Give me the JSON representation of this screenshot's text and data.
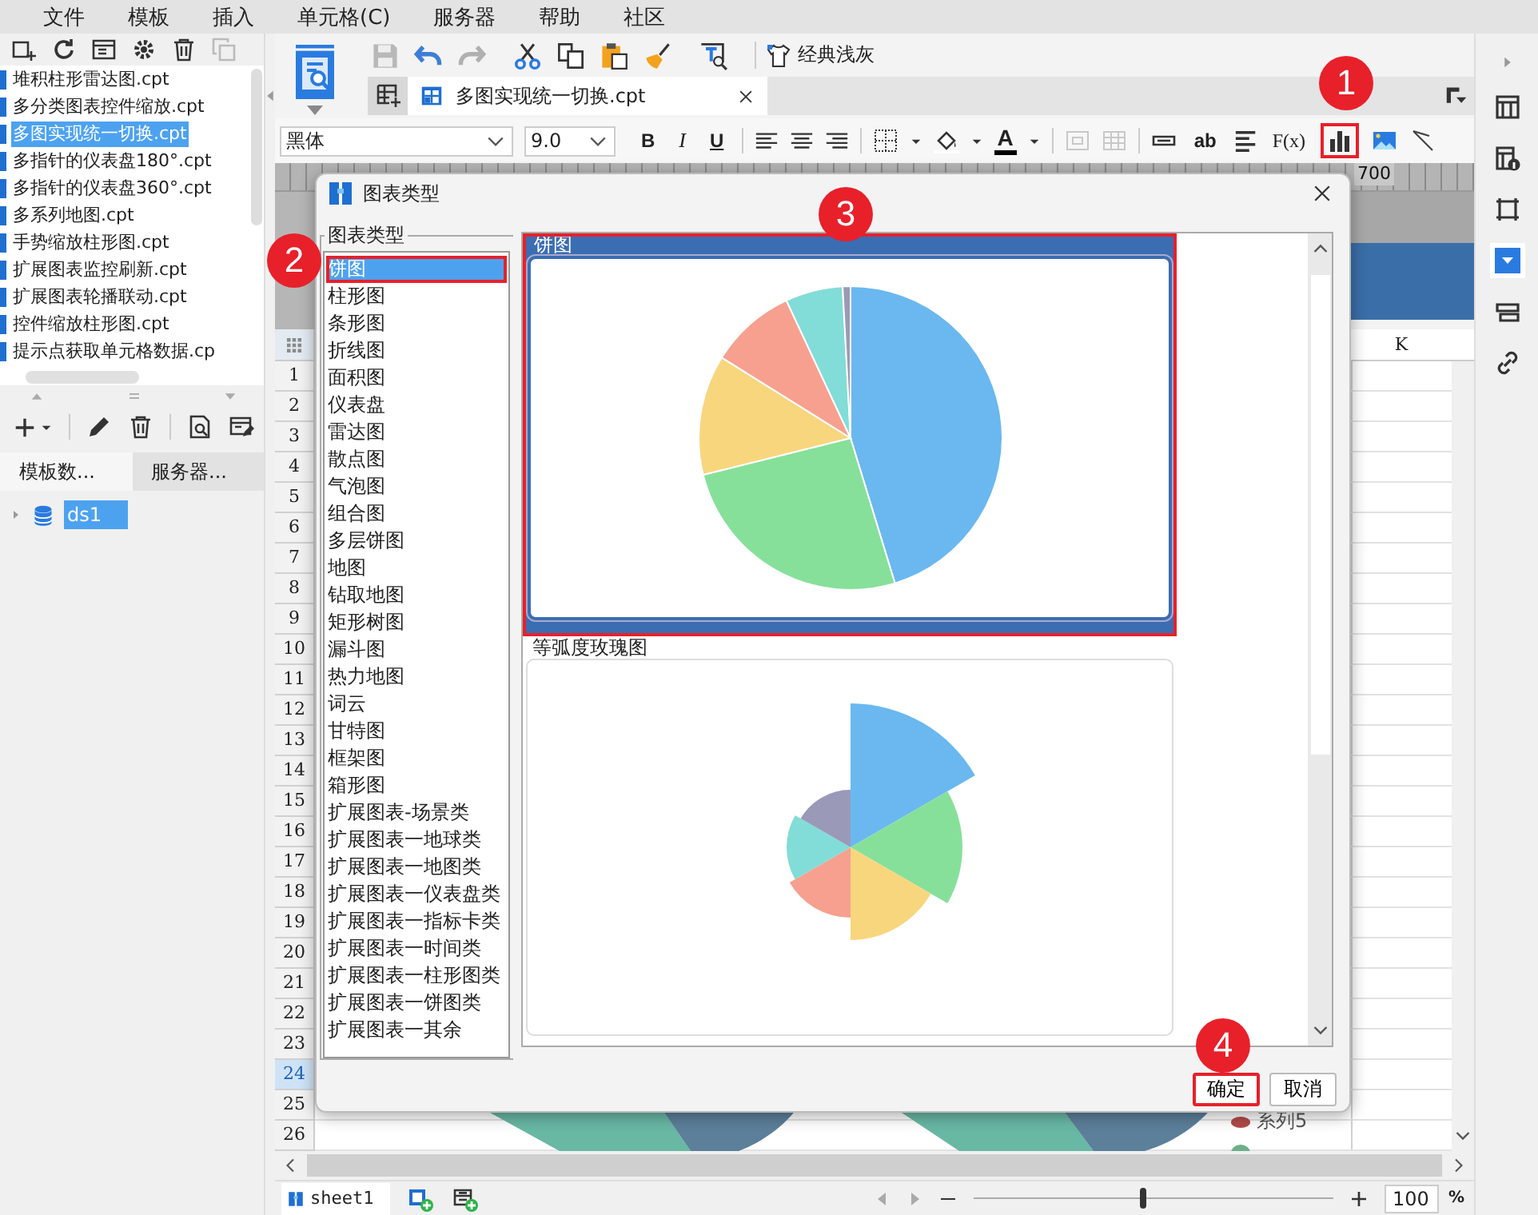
{
  "menu": [
    "文件",
    "模板",
    "插入",
    "单元格(C)",
    "服务器",
    "帮助",
    "社区"
  ],
  "files": [
    {
      "name": "堆积柱形雷达图.cpt",
      "selected": false
    },
    {
      "name": "多分类图表控件缩放.cpt",
      "selected": false
    },
    {
      "name": "多图实现统一切换.cpt",
      "selected": true
    },
    {
      "name": "多指针的仪表盘180°.cpt",
      "selected": false
    },
    {
      "name": "多指针的仪表盘360°.cpt",
      "selected": false
    },
    {
      "name": "多系列地图.cpt",
      "selected": false
    },
    {
      "name": "手势缩放柱形图.cpt",
      "selected": false
    },
    {
      "name": "扩展图表监控刷新.cpt",
      "selected": false
    },
    {
      "name": "扩展图表轮播联动.cpt",
      "selected": false
    },
    {
      "name": "控件缩放柱形图.cpt",
      "selected": false
    },
    {
      "name": "提示点获取单元格数据.cp",
      "selected": false
    }
  ],
  "panel_tabs": [
    {
      "label": "模板数...",
      "selected": true
    },
    {
      "label": "服务器...",
      "selected": false
    }
  ],
  "datasources": [
    {
      "label": "ds1",
      "selected": true
    }
  ],
  "toolbar": {
    "theme_button": "经典浅灰"
  },
  "document_tab": {
    "title": "多图实现统一切换.cpt"
  },
  "format_bar": {
    "chart_marked": true,
    "font": "黑体",
    "size": "9.0",
    "bold": "B",
    "italic": "I",
    "underline": "U",
    "font_color": "A",
    "text_tool": "ab",
    "formula": "F(x)"
  },
  "ruler": {
    "label": "700"
  },
  "sheet": {
    "column_header": "K",
    "legend": [
      "系列5"
    ],
    "rows": [
      {
        "label": "1",
        "selected": false
      },
      {
        "label": "2",
        "selected": false
      },
      {
        "label": "3",
        "selected": false
      },
      {
        "label": "4",
        "selected": false
      },
      {
        "label": "5",
        "selected": false
      },
      {
        "label": "6",
        "selected": false
      },
      {
        "label": "7",
        "selected": false
      },
      {
        "label": "8",
        "selected": false
      },
      {
        "label": "9",
        "selected": false
      },
      {
        "label": "10",
        "selected": false
      },
      {
        "label": "11",
        "selected": false
      },
      {
        "label": "12",
        "selected": false
      },
      {
        "label": "13",
        "selected": false
      },
      {
        "label": "14",
        "selected": false
      },
      {
        "label": "15",
        "selected": false
      },
      {
        "label": "16",
        "selected": false
      },
      {
        "label": "17",
        "selected": false
      },
      {
        "label": "18",
        "selected": false
      },
      {
        "label": "19",
        "selected": false
      },
      {
        "label": "20",
        "selected": false
      },
      {
        "label": "21",
        "selected": false
      },
      {
        "label": "22",
        "selected": false
      },
      {
        "label": "23",
        "selected": false
      },
      {
        "label": "24",
        "selected": true
      },
      {
        "label": "25",
        "selected": false
      },
      {
        "label": "26",
        "selected": false
      }
    ]
  },
  "side_tools": [
    {
      "selected": false
    },
    {
      "selected": false
    },
    {
      "selected": false
    },
    {
      "selected": true
    },
    {
      "selected": false
    },
    {
      "selected": false
    }
  ],
  "status": {
    "sheet_tab": "sheet1",
    "zoom": "100",
    "zoom_unit": "%",
    "level": 0.47
  },
  "dialog": {
    "title": "图表类型",
    "group_label": "图表类型",
    "marked_chart_type": true,
    "chart_types": [
      {
        "label": "饼图",
        "selected": true
      },
      {
        "label": "柱形图",
        "selected": false
      },
      {
        "label": "条形图",
        "selected": false
      },
      {
        "label": "折线图",
        "selected": false
      },
      {
        "label": "面积图",
        "selected": false
      },
      {
        "label": "仪表盘",
        "selected": false
      },
      {
        "label": "雷达图",
        "selected": false
      },
      {
        "label": "散点图",
        "selected": false
      },
      {
        "label": "气泡图",
        "selected": false
      },
      {
        "label": "组合图",
        "selected": false
      },
      {
        "label": "多层饼图",
        "selected": false
      },
      {
        "label": "地图",
        "selected": false
      },
      {
        "label": "钻取地图",
        "selected": false
      },
      {
        "label": "矩形树图",
        "selected": false
      },
      {
        "label": "漏斗图",
        "selected": false
      },
      {
        "label": "热力地图",
        "selected": false
      },
      {
        "label": "词云",
        "selected": false
      },
      {
        "label": "甘特图",
        "selected": false
      },
      {
        "label": "框架图",
        "selected": false
      },
      {
        "label": "箱形图",
        "selected": false
      },
      {
        "label": "扩展图表-场景类",
        "selected": false
      },
      {
        "label": "扩展图表一地球类",
        "selected": false
      },
      {
        "label": "扩展图表一地图类",
        "selected": false
      },
      {
        "label": "扩展图表一仪表盘类",
        "selected": false
      },
      {
        "label": "扩展图表一指标卡类",
        "selected": false
      },
      {
        "label": "扩展图表一时间类",
        "selected": false
      },
      {
        "label": "扩展图表一柱形图类",
        "selected": false
      },
      {
        "label": "扩展图表一饼图类",
        "selected": false
      },
      {
        "label": "扩展图表一其余",
        "selected": false
      }
    ],
    "previews": [
      {
        "label": "饼图",
        "kind": "pie",
        "selected": true,
        "marked": true
      },
      {
        "label": "等弧度玫瑰图",
        "kind": "rose",
        "selected": false,
        "marked": false
      }
    ],
    "buttons": [
      {
        "label": "确定",
        "marked": true
      },
      {
        "label": "取消",
        "marked": false
      }
    ]
  },
  "annotations": [
    {
      "label": "1"
    },
    {
      "label": "2"
    },
    {
      "label": "3"
    },
    {
      "label": "4"
    }
  ]
}
